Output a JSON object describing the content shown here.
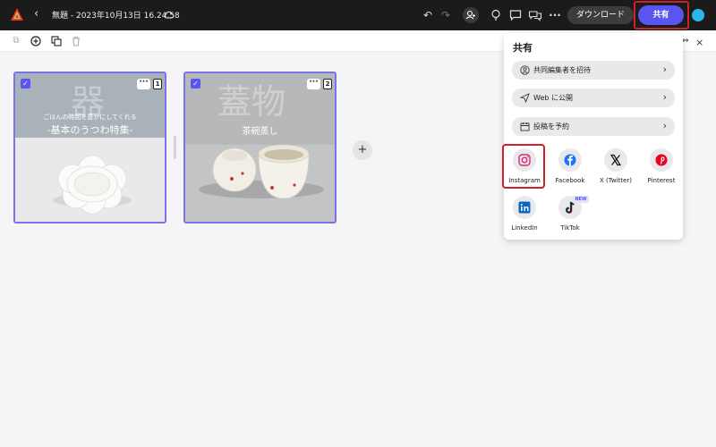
{
  "header": {
    "title": "無題 - 2023年10月13日 16.24.58",
    "download_label": "ダウンロード",
    "share_label": "共有"
  },
  "icons": {
    "logo": "adobe-express-logo",
    "back": "chevron-left-icon",
    "cloud": "cloud-sync-icon",
    "undo": "undo-icon",
    "redo": "redo-icon",
    "invite": "invite-person-icon",
    "lightbulb": "lightbulb-icon",
    "comment": "comment-icon",
    "collab": "collaborate-icon",
    "more": "more-icon"
  },
  "pages": [
    {
      "number": "1",
      "kanji": "器",
      "line1": "ごはんの時間を豊かにしてくれる",
      "line2": "-基本のうつわ特集-"
    },
    {
      "number": "2",
      "kanji": "蓋物",
      "line1": "茶碗蒸し"
    }
  ],
  "share_panel": {
    "title": "共有",
    "rows": [
      {
        "label": "共同編集者を招待",
        "icon": "invite-icon"
      },
      {
        "label": "Web に公開",
        "icon": "send-icon"
      },
      {
        "label": "投稿を予約",
        "icon": "calendar-icon"
      }
    ],
    "socials": [
      {
        "label": "Instagram",
        "icon": "instagram-icon"
      },
      {
        "label": "Facebook",
        "icon": "facebook-icon"
      },
      {
        "label": "X (Twitter)",
        "icon": "x-twitter-icon"
      },
      {
        "label": "Pinterest",
        "icon": "pinterest-icon"
      },
      {
        "label": "LinkedIn",
        "icon": "linkedin-icon"
      },
      {
        "label": "TikTok",
        "icon": "tiktok-icon",
        "badge": "NEW"
      }
    ]
  },
  "colors": {
    "accent": "#5a55f0",
    "highlight": "#d0202e",
    "topbar": "#1b1b1b",
    "selection": "#7a74ea"
  }
}
